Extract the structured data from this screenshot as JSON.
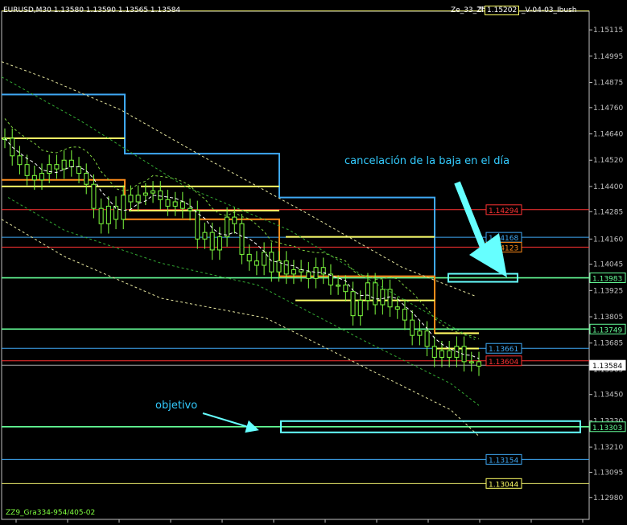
{
  "header": {
    "symbol_info": "EURUSD,M30 1.13580 1.13590 1.13565 1.13584",
    "indicator_label": "Ze_33_Zhi...",
    "indicator_box_value": "1.15202",
    "indicator_suffix": "_V-04-03_Ibush",
    "bottom_label": "ZZ9_Gra334-954/405-02"
  },
  "colors": {
    "background": "#000000",
    "axis": "#c0c0c0",
    "candle": "#7fff3f",
    "blue_step": "#3fa9f5",
    "orange_step": "#ff8c1a",
    "yellow": "#ffff66",
    "green_line": "#66ff99",
    "red_line": "#ff3333",
    "annotation": "#33ccff",
    "box": "#66ffff"
  },
  "chart_data": {
    "type": "candlestick",
    "ylim": [
      1.1288,
      1.152
    ],
    "y_ticks": [
      "1.15115",
      "1.14995",
      "1.14875",
      "1.14760",
      "1.14640",
      "1.14520",
      "1.14400",
      "1.14285",
      "1.14160",
      "1.14045",
      "1.13925",
      "1.13805",
      "1.13685",
      "1.13565",
      "1.13450",
      "1.13330",
      "1.13210",
      "1.13095",
      "1.12980"
    ],
    "price_tags": [
      {
        "label": "1.14294",
        "value": 1.14294,
        "kind": "red"
      },
      {
        "label": "1.14168",
        "value": 1.14168,
        "kind": "blue"
      },
      {
        "label": "1.14123",
        "value": 1.14123,
        "kind": "orange"
      },
      {
        "label": "1.13983",
        "value": 1.13983,
        "kind": "green"
      },
      {
        "label": "1.13749",
        "value": 1.13749,
        "kind": "green"
      },
      {
        "label": "1.13661",
        "value": 1.13661,
        "kind": "blue"
      },
      {
        "label": "1.13604",
        "value": 1.13604,
        "kind": "red"
      },
      {
        "label": "1.13584",
        "value": 1.13584,
        "kind": "current"
      },
      {
        "label": "1.13303",
        "value": 1.13303,
        "kind": "green"
      },
      {
        "label": "1.13154",
        "value": 1.13154,
        "kind": "blue"
      },
      {
        "label": "1.13044",
        "value": 1.13044,
        "kind": "yellow"
      }
    ],
    "close_series": [
      1.1462,
      1.1454,
      1.145,
      1.1445,
      1.1443,
      1.1446,
      1.145,
      1.1448,
      1.1452,
      1.1449,
      1.1446,
      1.1441,
      1.143,
      1.1423,
      1.1431,
      1.1425,
      1.1436,
      1.1433,
      1.1436,
      1.1437,
      1.1438,
      1.1434,
      1.1431,
      1.1433,
      1.143,
      1.1429,
      1.1416,
      1.1419,
      1.1411,
      1.1417,
      1.1426,
      1.1423,
      1.1409,
      1.1406,
      1.1404,
      1.141,
      1.1401,
      1.1406,
      1.14,
      1.1402,
      1.1401,
      1.1398,
      1.1403,
      1.14,
      1.1395,
      1.1395,
      1.1392,
      1.1381,
      1.1388,
      1.1396,
      1.1386,
      1.1393,
      1.1385,
      1.1384,
      1.1379,
      1.1372,
      1.1374,
      1.1367,
      1.1362,
      1.1365,
      1.1362,
      1.1367,
      1.136,
      1.136,
      1.1358
    ],
    "annotations": {
      "cancel_text": "cancelación de la baja en el día",
      "target_text": "objetivo"
    }
  }
}
